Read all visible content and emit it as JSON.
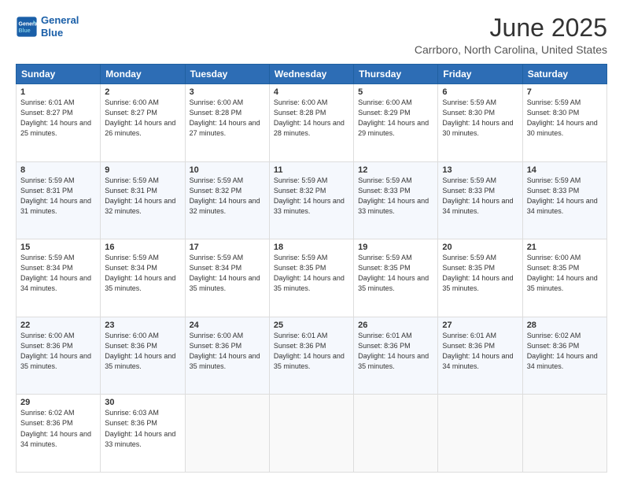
{
  "header": {
    "logo_line1": "General",
    "logo_line2": "Blue",
    "title": "June 2025",
    "subtitle": "Carrboro, North Carolina, United States"
  },
  "days_of_week": [
    "Sunday",
    "Monday",
    "Tuesday",
    "Wednesday",
    "Thursday",
    "Friday",
    "Saturday"
  ],
  "weeks": [
    [
      {
        "day": "1",
        "sunrise": "6:01 AM",
        "sunset": "8:27 PM",
        "daylight": "14 hours and 25 minutes."
      },
      {
        "day": "2",
        "sunrise": "6:00 AM",
        "sunset": "8:27 PM",
        "daylight": "14 hours and 26 minutes."
      },
      {
        "day": "3",
        "sunrise": "6:00 AM",
        "sunset": "8:28 PM",
        "daylight": "14 hours and 27 minutes."
      },
      {
        "day": "4",
        "sunrise": "6:00 AM",
        "sunset": "8:28 PM",
        "daylight": "14 hours and 28 minutes."
      },
      {
        "day": "5",
        "sunrise": "6:00 AM",
        "sunset": "8:29 PM",
        "daylight": "14 hours and 29 minutes."
      },
      {
        "day": "6",
        "sunrise": "5:59 AM",
        "sunset": "8:30 PM",
        "daylight": "14 hours and 30 minutes."
      },
      {
        "day": "7",
        "sunrise": "5:59 AM",
        "sunset": "8:30 PM",
        "daylight": "14 hours and 30 minutes."
      }
    ],
    [
      {
        "day": "8",
        "sunrise": "5:59 AM",
        "sunset": "8:31 PM",
        "daylight": "14 hours and 31 minutes."
      },
      {
        "day": "9",
        "sunrise": "5:59 AM",
        "sunset": "8:31 PM",
        "daylight": "14 hours and 32 minutes."
      },
      {
        "day": "10",
        "sunrise": "5:59 AM",
        "sunset": "8:32 PM",
        "daylight": "14 hours and 32 minutes."
      },
      {
        "day": "11",
        "sunrise": "5:59 AM",
        "sunset": "8:32 PM",
        "daylight": "14 hours and 33 minutes."
      },
      {
        "day": "12",
        "sunrise": "5:59 AM",
        "sunset": "8:33 PM",
        "daylight": "14 hours and 33 minutes."
      },
      {
        "day": "13",
        "sunrise": "5:59 AM",
        "sunset": "8:33 PM",
        "daylight": "14 hours and 34 minutes."
      },
      {
        "day": "14",
        "sunrise": "5:59 AM",
        "sunset": "8:33 PM",
        "daylight": "14 hours and 34 minutes."
      }
    ],
    [
      {
        "day": "15",
        "sunrise": "5:59 AM",
        "sunset": "8:34 PM",
        "daylight": "14 hours and 34 minutes."
      },
      {
        "day": "16",
        "sunrise": "5:59 AM",
        "sunset": "8:34 PM",
        "daylight": "14 hours and 35 minutes."
      },
      {
        "day": "17",
        "sunrise": "5:59 AM",
        "sunset": "8:34 PM",
        "daylight": "14 hours and 35 minutes."
      },
      {
        "day": "18",
        "sunrise": "5:59 AM",
        "sunset": "8:35 PM",
        "daylight": "14 hours and 35 minutes."
      },
      {
        "day": "19",
        "sunrise": "5:59 AM",
        "sunset": "8:35 PM",
        "daylight": "14 hours and 35 minutes."
      },
      {
        "day": "20",
        "sunrise": "5:59 AM",
        "sunset": "8:35 PM",
        "daylight": "14 hours and 35 minutes."
      },
      {
        "day": "21",
        "sunrise": "6:00 AM",
        "sunset": "8:35 PM",
        "daylight": "14 hours and 35 minutes."
      }
    ],
    [
      {
        "day": "22",
        "sunrise": "6:00 AM",
        "sunset": "8:36 PM",
        "daylight": "14 hours and 35 minutes."
      },
      {
        "day": "23",
        "sunrise": "6:00 AM",
        "sunset": "8:36 PM",
        "daylight": "14 hours and 35 minutes."
      },
      {
        "day": "24",
        "sunrise": "6:00 AM",
        "sunset": "8:36 PM",
        "daylight": "14 hours and 35 minutes."
      },
      {
        "day": "25",
        "sunrise": "6:01 AM",
        "sunset": "8:36 PM",
        "daylight": "14 hours and 35 minutes."
      },
      {
        "day": "26",
        "sunrise": "6:01 AM",
        "sunset": "8:36 PM",
        "daylight": "14 hours and 35 minutes."
      },
      {
        "day": "27",
        "sunrise": "6:01 AM",
        "sunset": "8:36 PM",
        "daylight": "14 hours and 34 minutes."
      },
      {
        "day": "28",
        "sunrise": "6:02 AM",
        "sunset": "8:36 PM",
        "daylight": "14 hours and 34 minutes."
      }
    ],
    [
      {
        "day": "29",
        "sunrise": "6:02 AM",
        "sunset": "8:36 PM",
        "daylight": "14 hours and 34 minutes."
      },
      {
        "day": "30",
        "sunrise": "6:03 AM",
        "sunset": "8:36 PM",
        "daylight": "14 hours and 33 minutes."
      },
      null,
      null,
      null,
      null,
      null
    ]
  ]
}
